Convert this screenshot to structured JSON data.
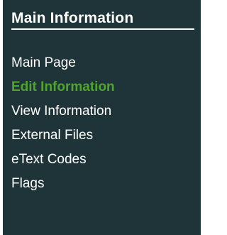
{
  "section": {
    "title": "Main Information"
  },
  "nav": {
    "items": [
      {
        "label": "Main Page",
        "active": false
      },
      {
        "label": "Edit Information",
        "active": true
      },
      {
        "label": "View Information",
        "active": false
      },
      {
        "label": "External Files",
        "active": false
      },
      {
        "label": "eText Codes",
        "active": false
      },
      {
        "label": "Flags",
        "active": false
      }
    ]
  },
  "colors": {
    "panel_background": "#1e3438",
    "text": "#ffffff",
    "active_link": "#4fa62f"
  }
}
